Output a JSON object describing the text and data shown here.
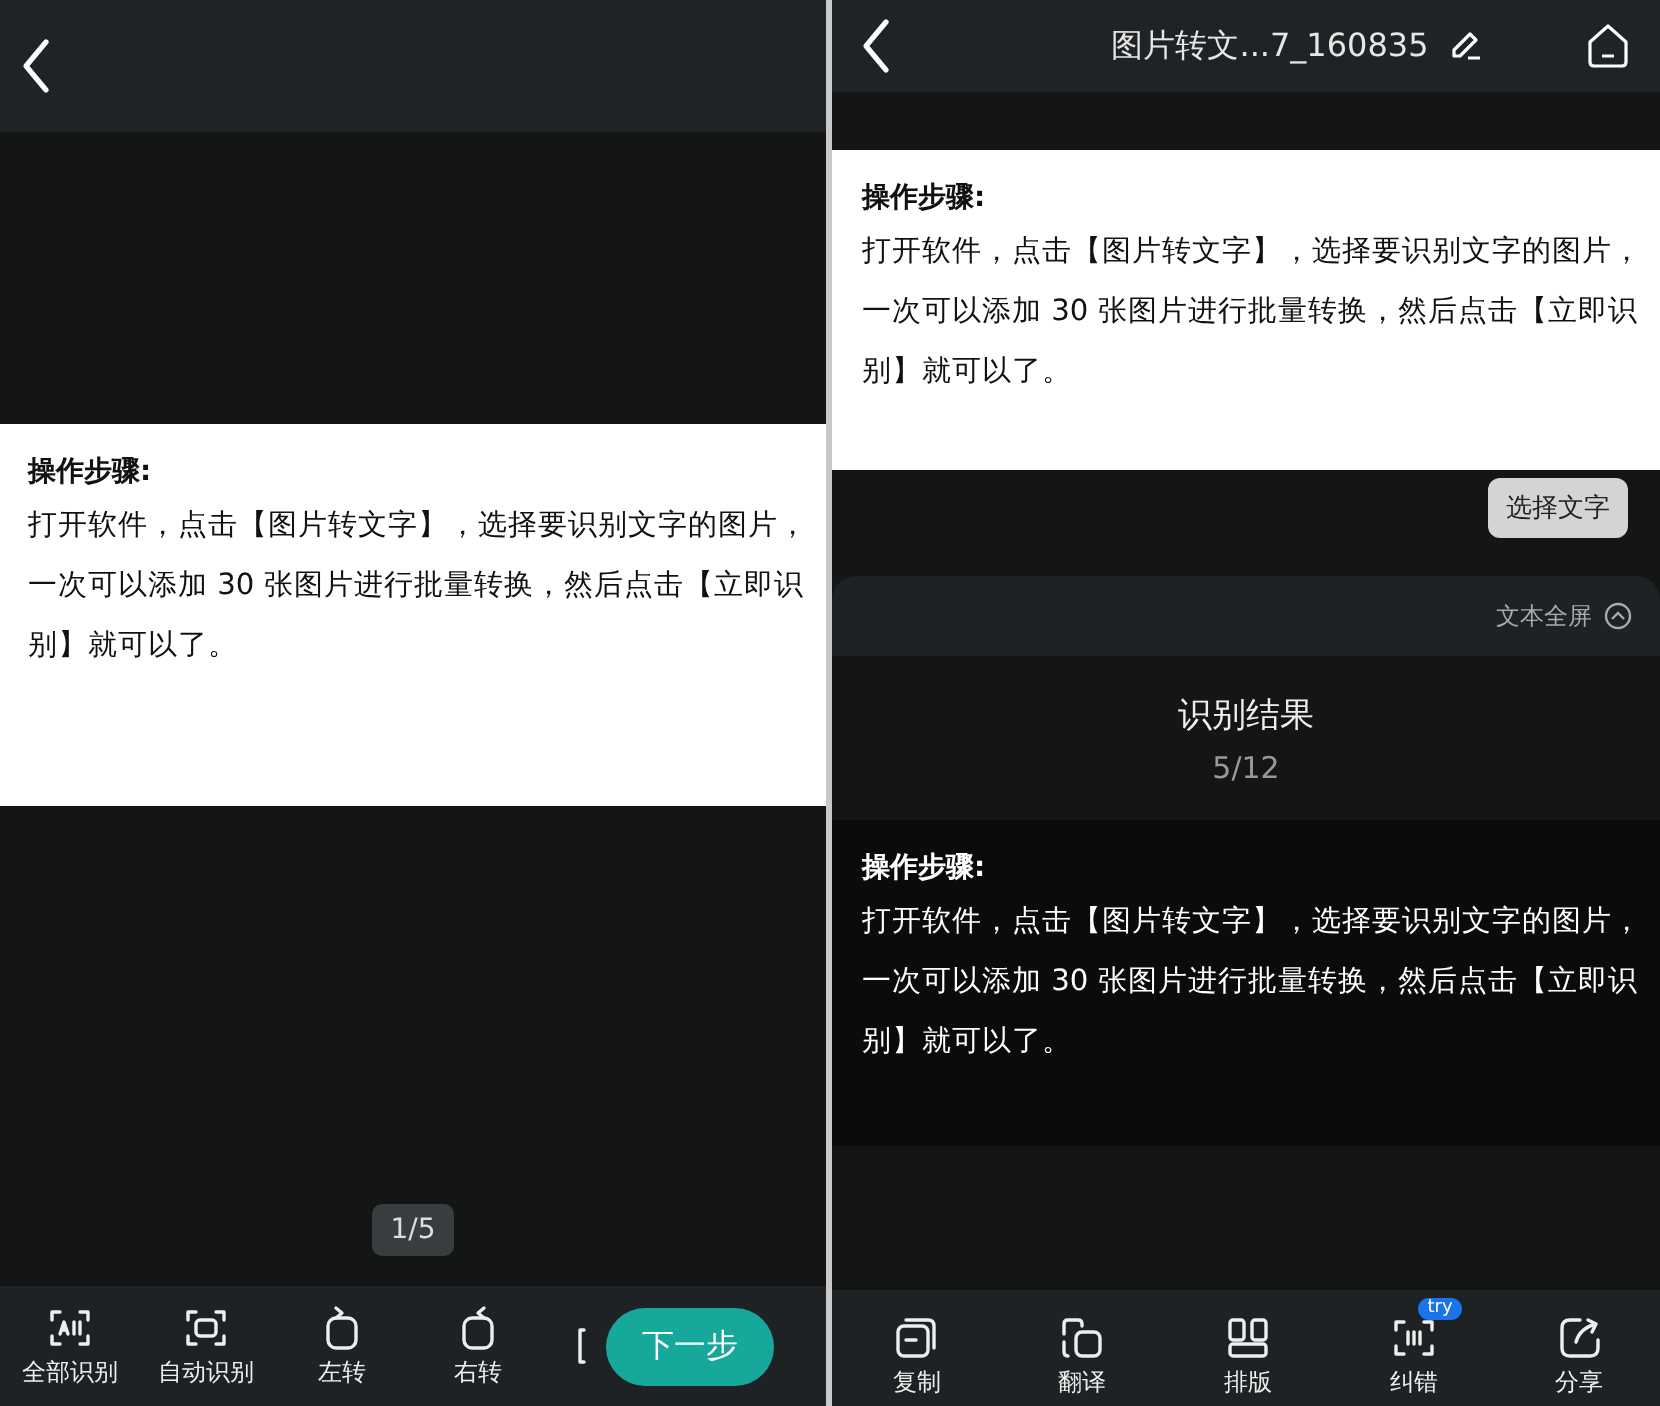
{
  "left_screen": {
    "document": {
      "heading": "操作步骤:",
      "lines": [
        "打开软件，点击【图片转文字】，选择要识别文字的图片，",
        "一次可以添加 30 张图片进行批量转换，然后点击【立即识",
        "别】就可以了。"
      ]
    },
    "page_counter": "1/5",
    "toolbar": [
      {
        "kind": "all",
        "label": "全部识别"
      },
      {
        "kind": "auto",
        "label": "自动识别"
      },
      {
        "kind": "rotate_left",
        "label": "左转"
      },
      {
        "kind": "rotate_right",
        "label": "右转"
      },
      {
        "kind": "partial"
      }
    ],
    "next_button": "下一步"
  },
  "right_screen": {
    "title": "图片转文...7_160835",
    "document": {
      "heading": "操作步骤:",
      "lines": [
        "打开软件，点击【图片转文字】，选择要识别文字的图片，",
        "一次可以添加 30 张图片进行批量转换，然后点击【立即识",
        "别】就可以了。"
      ]
    },
    "select_text_button": "选择文字",
    "fullscreen_toggle": "文本全屏",
    "result_title": "识别结果",
    "result_counter": "5/12",
    "result_text": {
      "heading": "操作步骤:",
      "lines": [
        "打开软件，点击【图片转文字】，选择要识别文字的图片，",
        "一次可以添加 30 张图片进行批量转换，然后点击【立即识",
        "别】就可以了。"
      ]
    },
    "toolbar": [
      {
        "kind": "copy",
        "label": "复制"
      },
      {
        "kind": "translate",
        "label": "翻译"
      },
      {
        "kind": "layout",
        "label": "排版"
      },
      {
        "kind": "correct",
        "label": "纠错",
        "badge": "try"
      },
      {
        "kind": "share",
        "label": "分享"
      }
    ]
  }
}
